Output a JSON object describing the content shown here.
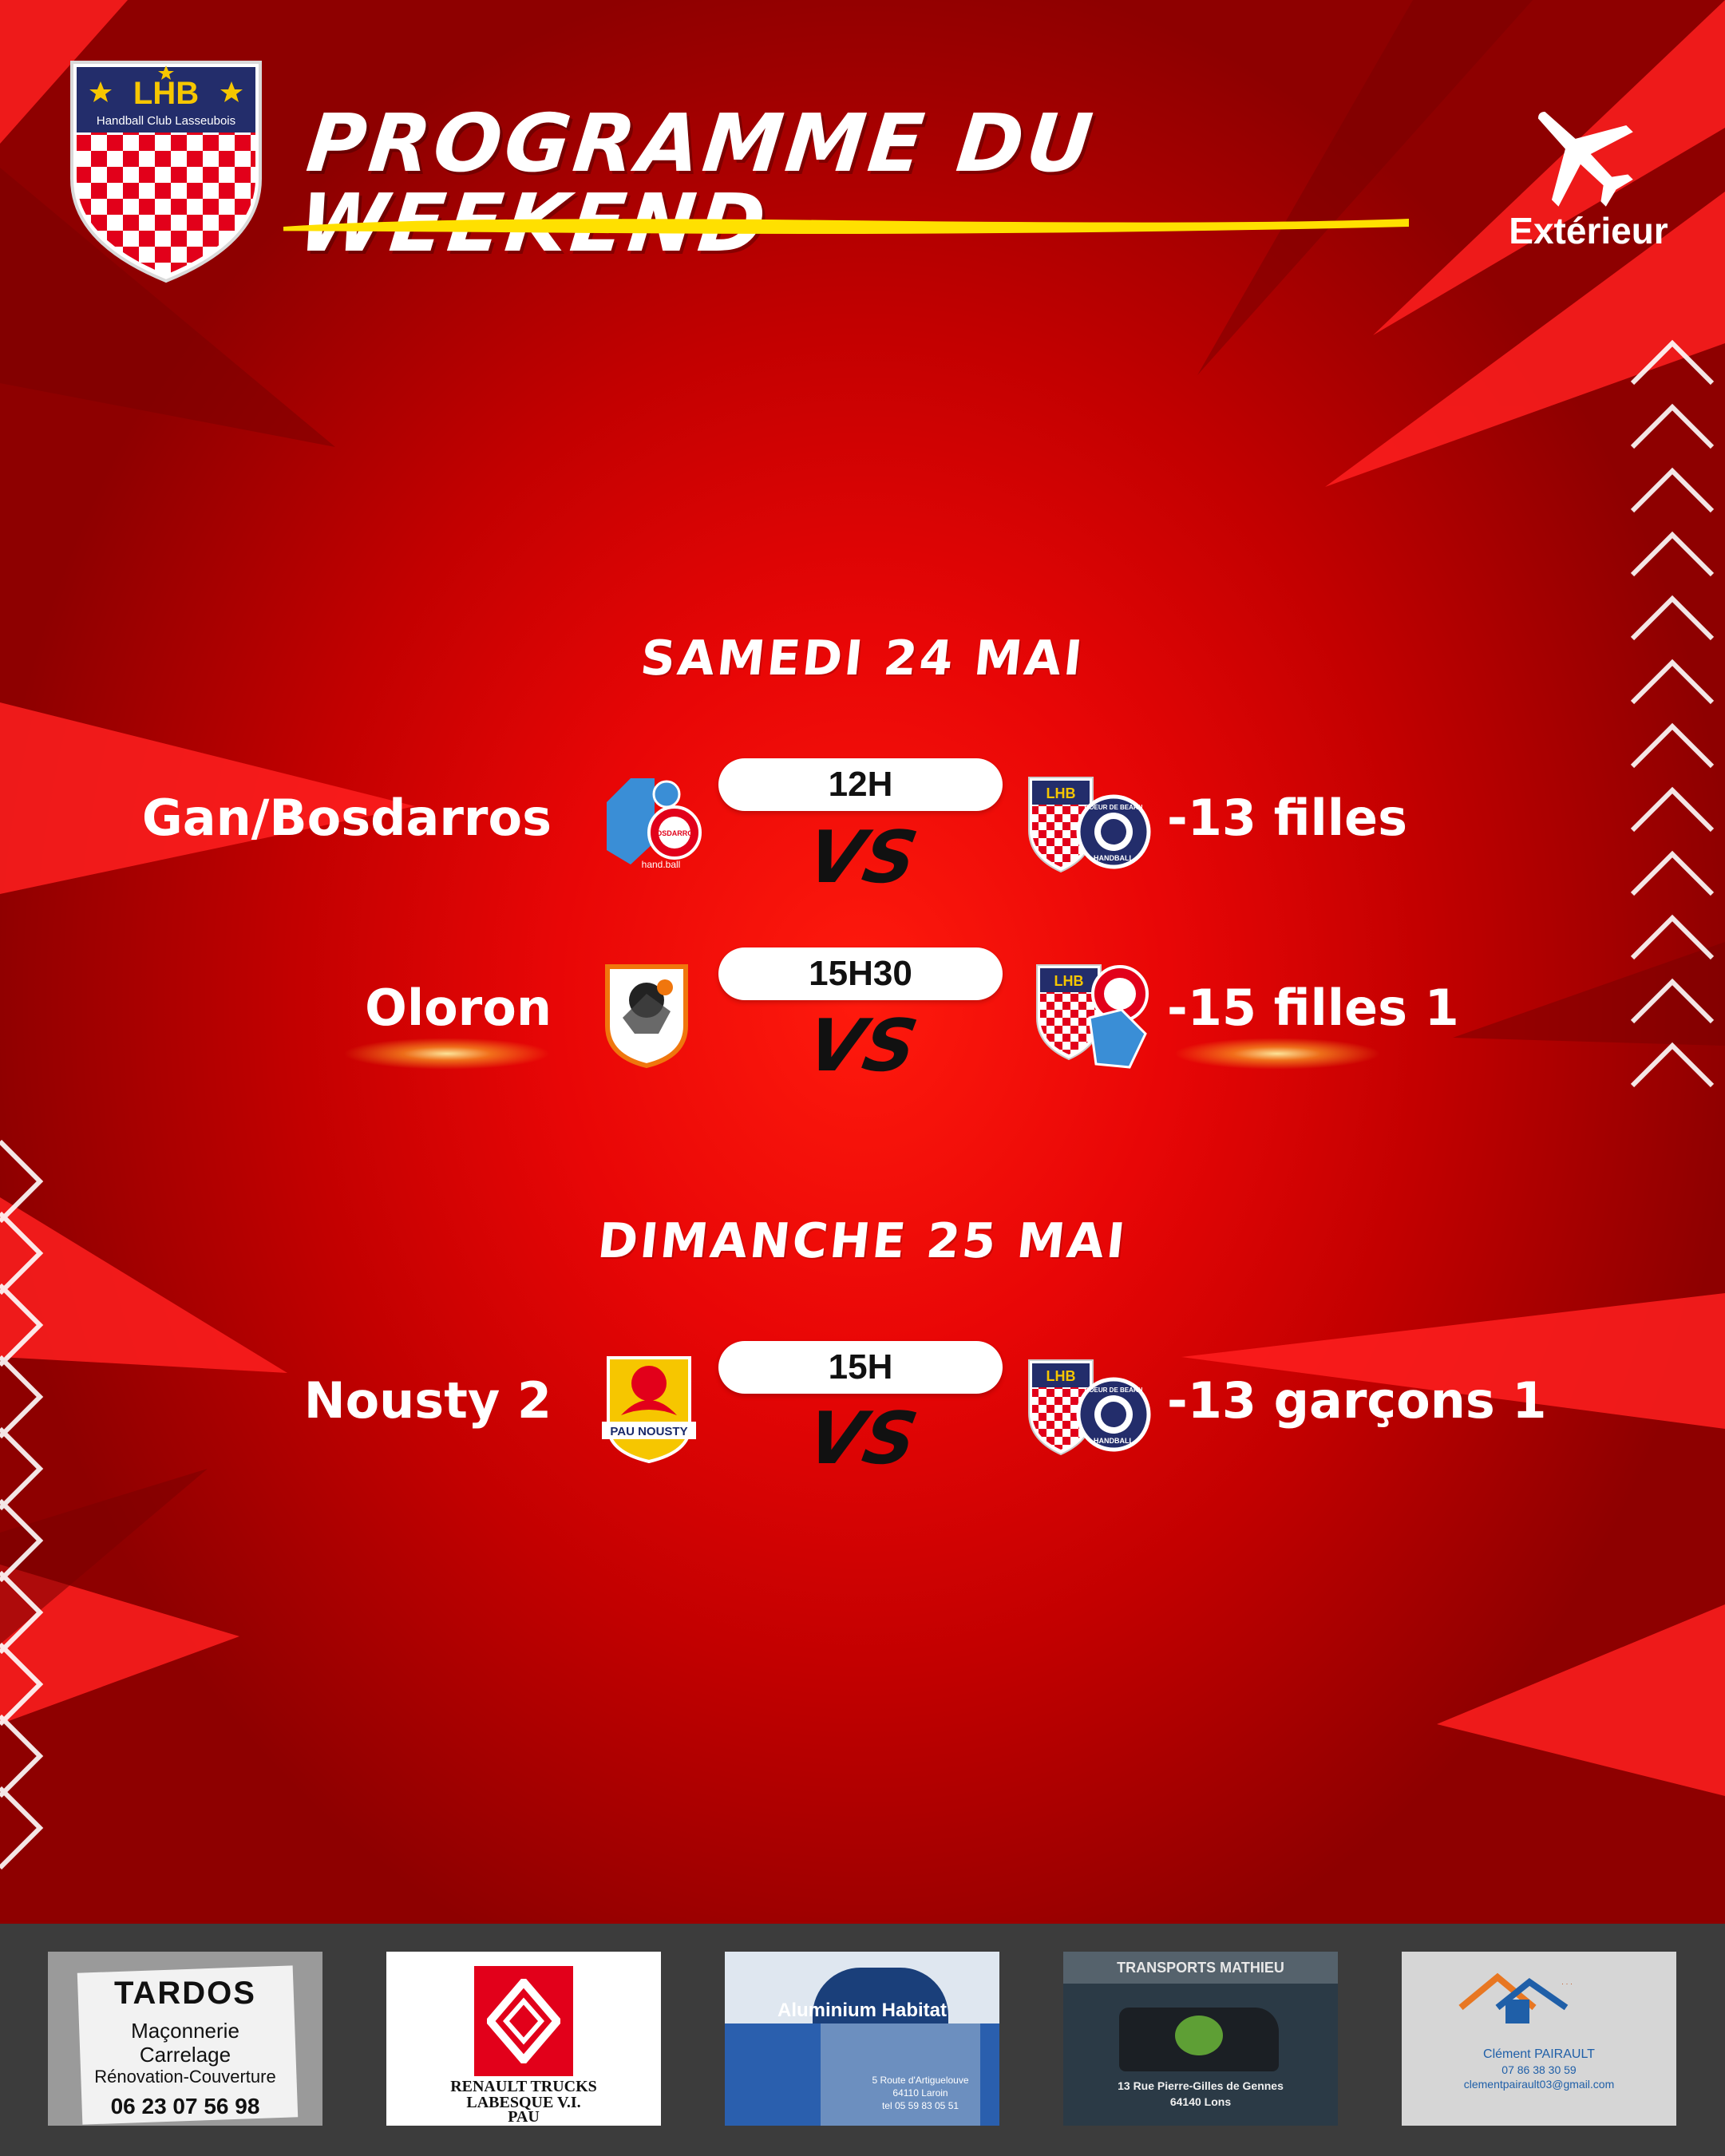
{
  "header": {
    "club_logo": {
      "abbr": "LHB",
      "name": "Handball Club Lasseubois"
    },
    "title": "PROGRAMME DU WEEKEND",
    "location_label": "Extérieur",
    "location_icon": "airplane-icon"
  },
  "days": [
    {
      "label": "SAMEDI 24 MAI",
      "matches": [
        {
          "time": "12H",
          "home": "Gan/Bosdarros",
          "away": "-13 filles",
          "vs": "VS"
        },
        {
          "time": "15H30",
          "home": "Oloron",
          "away": "-15 filles 1",
          "vs": "VS"
        }
      ]
    },
    {
      "label": "DIMANCHE 25 MAI",
      "matches": [
        {
          "time": "15H",
          "home": "Nousty 2",
          "away": "-13 garçons 1",
          "vs": "VS"
        }
      ]
    }
  ],
  "team_logos": {
    "bosdarros": {
      "top": "BOSDARROS",
      "bottom": "hand.ball"
    },
    "coeur_bearn": {
      "top": "COEUR DE BEARN",
      "bottom": "HANDBALL"
    },
    "pau_nousty": {
      "text": "PAU NOUSTY"
    }
  },
  "sponsors": [
    {
      "name": "TARDOS",
      "lines": [
        "Maçonnerie",
        "Carrelage",
        "Rénovation-Couverture"
      ],
      "phone": "06 23 07 56 98"
    },
    {
      "name": "RENAULT TRUCKS",
      "lines": [
        "LABESQUE V.I.",
        "PAU"
      ]
    },
    {
      "name": "Aluminium Habitat",
      "lines": [
        "5 Route d'Artiguelouve",
        "64110 Laroin",
        "tel 05 59 83 05 51"
      ]
    },
    {
      "name": "TRANSPORTS MATHIEU",
      "lines": [
        "13 Rue Pierre-Gilles de Gennes",
        "64140 Lons"
      ]
    },
    {
      "name": "Clément PAIRAULT",
      "lines": [
        "07 86 38 30 59",
        "clementpairault03@gmail.com"
      ]
    }
  ],
  "colors": {
    "accent_red": "#e00000",
    "underline_yellow": "#ffe000",
    "navy": "#232d6b"
  }
}
